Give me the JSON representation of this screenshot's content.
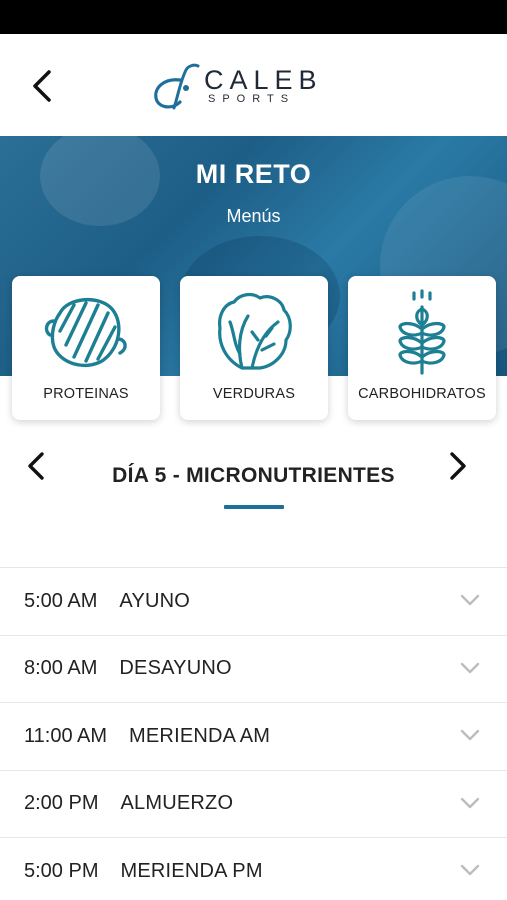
{
  "header": {
    "logo_main": "CALEB",
    "logo_sub": "SPORTS",
    "back_icon": "chevron-left-icon"
  },
  "hero": {
    "title": "MI RETO",
    "subtitle": "Menús"
  },
  "categories": [
    {
      "label": "PROTEINAS",
      "icon": "steak-icon"
    },
    {
      "label": "VERDURAS",
      "icon": "lettuce-icon"
    },
    {
      "label": "CARBOHIDRATOS",
      "icon": "wheat-icon"
    }
  ],
  "day_nav": {
    "title": "DÍA 5 - MICRONUTRIENTES",
    "prev_icon": "chevron-left-icon",
    "next_icon": "chevron-right-icon"
  },
  "meals": [
    {
      "time": "5:00 AM",
      "name": "AYUNO"
    },
    {
      "time": "8:00 AM",
      "name": "DESAYUNO"
    },
    {
      "time": "11:00 AM",
      "name": "MERIENDA AM"
    },
    {
      "time": "2:00 PM",
      "name": "ALMUERZO"
    },
    {
      "time": "5:00 PM",
      "name": "MERIENDA PM"
    }
  ],
  "colors": {
    "accent": "#1e6f9a",
    "icon_teal": "#1d7f93",
    "hero_blue": "#1d5e86"
  }
}
